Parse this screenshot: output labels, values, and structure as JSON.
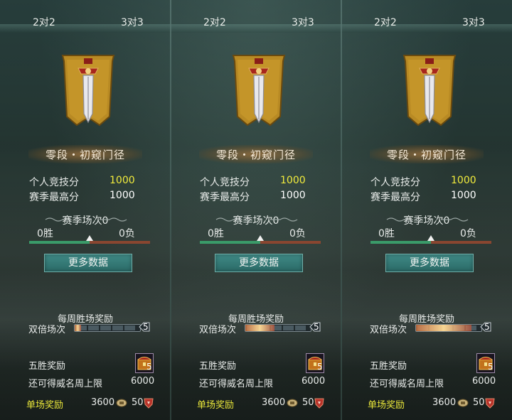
{
  "colors": {
    "highlight_yellow": "#f2ec3c",
    "win_green": "#3a9b69",
    "loss_red": "#8a4630",
    "button_teal": "#3f8a86"
  },
  "panels": [
    {
      "tabs": [
        "2对2",
        "3对3"
      ],
      "emblem_icon": "sword-banner-icon",
      "rank_name": "零段・初窥门径",
      "personal_score_label": "个人竞技分",
      "personal_score": "1000",
      "season_best_label": "赛季最高分",
      "season_best": "1000",
      "season_matches": "赛季场次0",
      "wins": "0胜",
      "losses": "0负",
      "win_fraction": 0.5,
      "more_data_button": "更多数据",
      "weekly_reward_title": "每周胜场奖励",
      "double_matches_label": "双倍场次",
      "double_progress": 0.1,
      "double_total": "5",
      "five_win_label": "五胜奖励",
      "five_win_count": "5",
      "weekly_cap_label": "还可得威名周上限",
      "weekly_cap": "6000",
      "single_reward_label": "单场奖励",
      "coin_reward": "3600",
      "honor_reward": "50"
    },
    {
      "tabs": [
        "2对2",
        "3对3"
      ],
      "emblem_icon": "sword-banner-icon",
      "rank_name": "零段・初窥门径",
      "personal_score_label": "个人竞技分",
      "personal_score": "1000",
      "season_best_label": "赛季最高分",
      "season_best": "1000",
      "season_matches": "赛季场次0",
      "wins": "0胜",
      "losses": "0负",
      "win_fraction": 0.5,
      "more_data_button": "更多数据",
      "weekly_reward_title": "每周胜场奖励",
      "double_matches_label": "双倍场次",
      "double_progress": 0.45,
      "double_total": "5",
      "five_win_label": "五胜奖励",
      "five_win_count": "5",
      "weekly_cap_label": "还可得威名周上限",
      "weekly_cap": "6000",
      "single_reward_label": "单场奖励",
      "coin_reward": "3600",
      "honor_reward": "50"
    },
    {
      "tabs": [
        "2对2",
        "3对3"
      ],
      "emblem_icon": "sword-banner-icon",
      "rank_name": "零段・初窥门径",
      "personal_score_label": "个人竞技分",
      "personal_score": "1000",
      "season_best_label": "赛季最高分",
      "season_best": "1000",
      "season_matches": "赛季场次0",
      "wins": "0胜",
      "losses": "0负",
      "win_fraction": 0.5,
      "more_data_button": "更多数据",
      "weekly_reward_title": "每周胜场奖励",
      "double_matches_label": "双倍场次",
      "double_progress": 0.85,
      "double_total": "5",
      "five_win_label": "五胜奖励",
      "five_win_count": "5",
      "weekly_cap_label": "还可得威名周上限",
      "weekly_cap": "6000",
      "single_reward_label": "单场奖励",
      "coin_reward": "3600",
      "honor_reward": "50"
    }
  ]
}
